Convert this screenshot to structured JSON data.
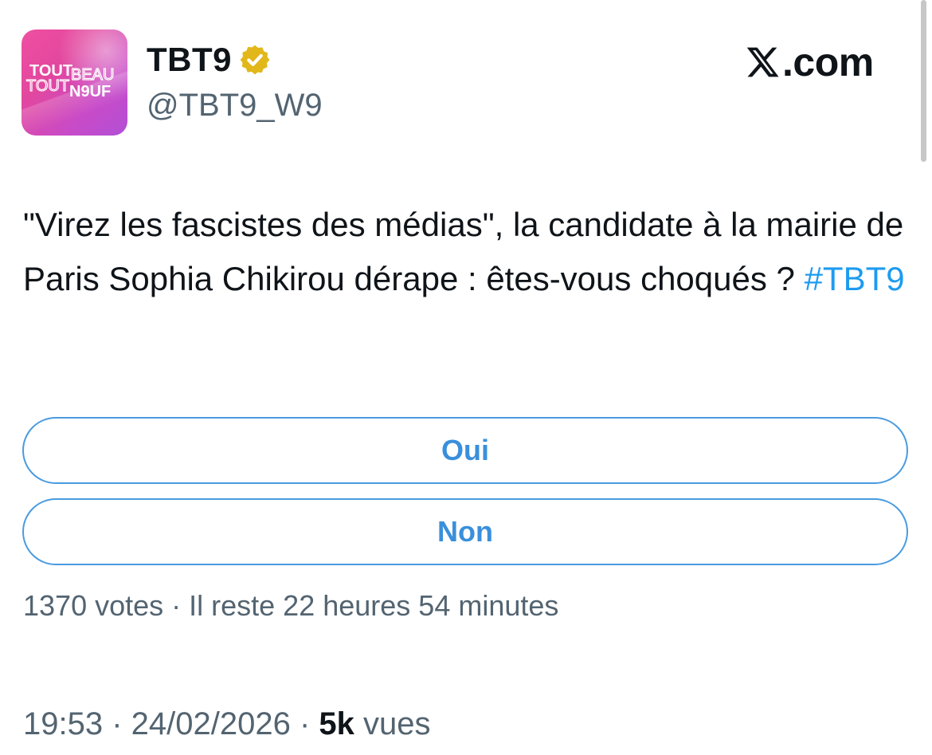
{
  "author": {
    "name": "TBT9",
    "handle": "@TBT9_W9",
    "avatar_logo_lines": [
      "TOUT",
      "BEAU",
      "TOUT",
      "N9UF"
    ],
    "verified_badge_color": "#e2b719"
  },
  "brand": {
    "label": ".com",
    "icon": "x-logo-icon"
  },
  "tweet": {
    "text": "\"Virez les fascistes des médias\", la candidate à la mairie de Paris Sophia Chikirou dérape : êtes-vous choqués ?",
    "hashtag": "#TBT9"
  },
  "poll": {
    "options": [
      {
        "label": "Oui"
      },
      {
        "label": "Non"
      }
    ],
    "votes": "1370 votes",
    "separator": " · ",
    "remaining": "Il reste 22 heures 54 minutes"
  },
  "meta": {
    "time": "19:53",
    "separator": " · ",
    "date": "24/02/2026",
    "views_count": "5k",
    "views_label": "vues"
  },
  "colors": {
    "accent": "#1d9bf0",
    "poll_border": "#4a9be0",
    "secondary_text": "#536471",
    "primary_text": "#0f1419"
  }
}
